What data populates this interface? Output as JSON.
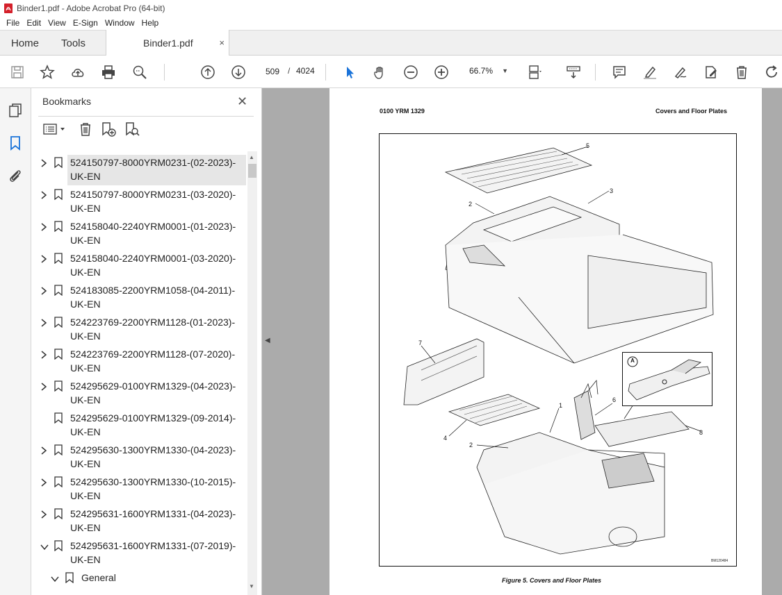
{
  "window": {
    "title": "Binder1.pdf - Adobe Acrobat Pro (64-bit)"
  },
  "menu": [
    "File",
    "Edit",
    "View",
    "E-Sign",
    "Window",
    "Help"
  ],
  "tabs": {
    "home": "Home",
    "tools": "Tools",
    "document": "Binder1.pdf",
    "close": "×"
  },
  "toolbar": {
    "page_current": "509",
    "page_separator": "/",
    "page_total": "4024",
    "zoom": "66.7%"
  },
  "bookmarks": {
    "header": "Bookmarks",
    "close": "✕",
    "items": [
      {
        "label": "524150797-8000YRM0231-(02-2023)-UK-EN",
        "expander": "collapsed",
        "selected": true
      },
      {
        "label": "524150797-8000YRM0231-(03-2020)-UK-EN",
        "expander": "collapsed"
      },
      {
        "label": "524158040-2240YRM0001-(01-2023)-UK-EN",
        "expander": "collapsed"
      },
      {
        "label": "524158040-2240YRM0001-(03-2020)-UK-EN",
        "expander": "collapsed"
      },
      {
        "label": "524183085-2200YRM1058-(04-2011)-UK-EN",
        "expander": "collapsed"
      },
      {
        "label": "524223769-2200YRM1128-(01-2023)-UK-EN",
        "expander": "collapsed"
      },
      {
        "label": "524223769-2200YRM1128-(07-2020)-UK-EN",
        "expander": "collapsed"
      },
      {
        "label": "524295629-0100YRM1329-(04-2023)-UK-EN",
        "expander": "collapsed"
      },
      {
        "label": "524295629-0100YRM1329-(09-2014)-UK-EN",
        "expander": "none"
      },
      {
        "label": "524295630-1300YRM1330-(04-2023)-UK-EN",
        "expander": "collapsed"
      },
      {
        "label": "524295630-1300YRM1330-(10-2015)-UK-EN",
        "expander": "collapsed"
      },
      {
        "label": "524295631-1600YRM1331-(04-2023)-UK-EN",
        "expander": "collapsed"
      },
      {
        "label": "524295631-1600YRM1331-(07-2019)-UK-EN",
        "expander": "expanded"
      }
    ],
    "child": {
      "label": "General",
      "expander": "expanded"
    }
  },
  "document": {
    "header_left": "0100 YRM 1329",
    "header_right": "Covers and Floor Plates",
    "caption": "Figure 5. Covers and Floor Plates",
    "figure_id": "BM120484",
    "inset_label": "A",
    "callouts": [
      "5",
      "3",
      "2",
      "7",
      "1",
      "6",
      "4",
      "2",
      "8"
    ]
  }
}
